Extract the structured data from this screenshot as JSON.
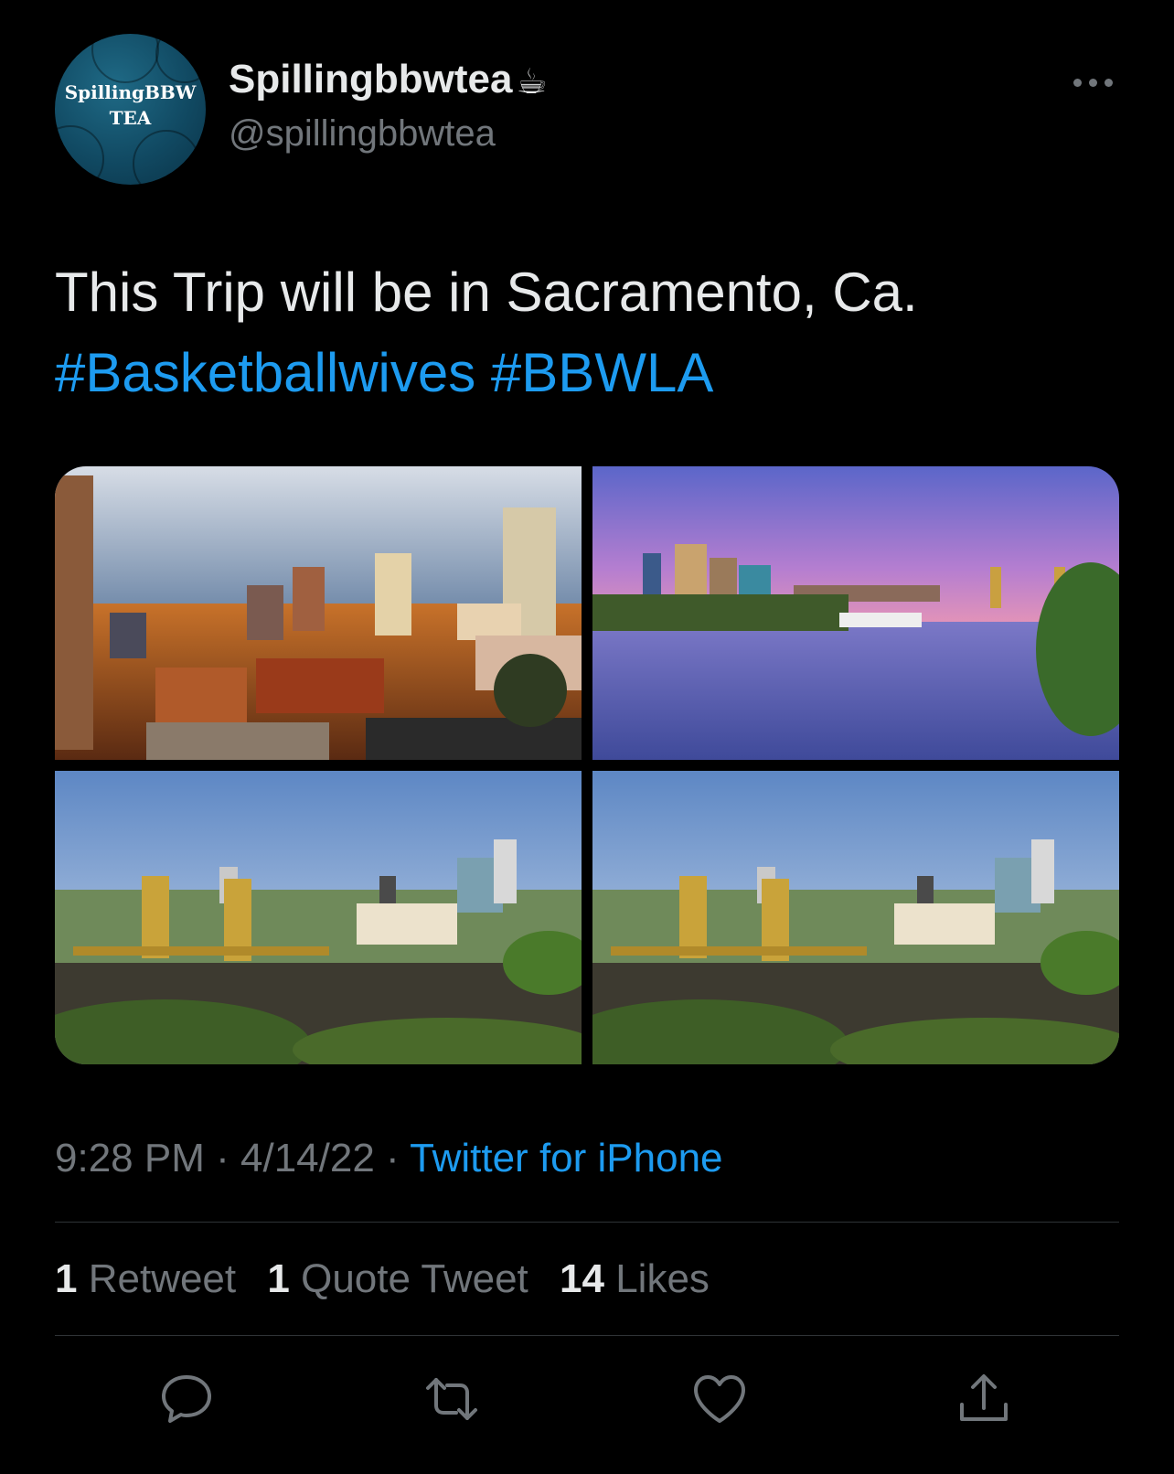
{
  "tweet": {
    "display_name": "Spillingbbwtea",
    "emoji": "☕",
    "handle": "@spillingbbwtea",
    "avatar": {
      "line1": "SpillingBBW",
      "line2": "TEA"
    },
    "text": "This Trip will be in Sacramento, Ca.",
    "hashtags": [
      "#Basketballwives",
      "#BBWLA"
    ],
    "time": "9:28 PM",
    "date": "4/14/22",
    "separator": "·",
    "source": "Twitter for iPhone",
    "stats": {
      "retweets_count": "1",
      "retweets_label": "Retweet",
      "quotes_count": "1",
      "quotes_label": "Quote Tweet",
      "likes_count": "14",
      "likes_label": "Likes"
    }
  },
  "icons": [
    "more-icon",
    "reply-icon",
    "retweet-icon",
    "like-icon",
    "share-icon"
  ],
  "colors": {
    "background": "#000000",
    "text": "#e7e9ea",
    "secondary": "#71767b",
    "link": "#1d9bf0",
    "divider": "#2f3336"
  }
}
